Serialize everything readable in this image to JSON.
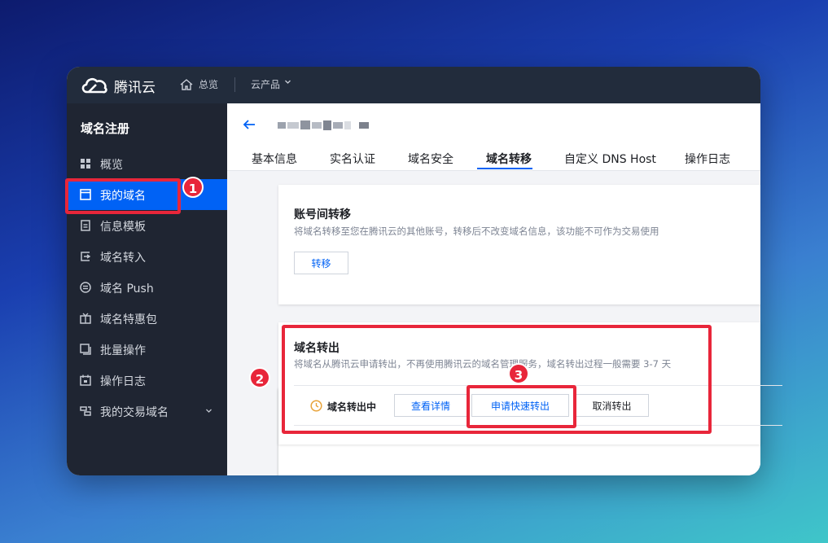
{
  "topbar": {
    "brand": "腾讯云",
    "home": "总览",
    "products": "云产品"
  },
  "sidebar": {
    "title": "域名注册",
    "items": [
      {
        "label": "概览",
        "icon": "grid-icon"
      },
      {
        "label": "我的域名",
        "icon": "window-icon",
        "active": true
      },
      {
        "label": "信息模板",
        "icon": "document-icon"
      },
      {
        "label": "域名转入",
        "icon": "transfer-in-icon"
      },
      {
        "label": "域名 Push",
        "icon": "push-icon"
      },
      {
        "label": "域名特惠包",
        "icon": "gift-icon"
      },
      {
        "label": "批量操作",
        "icon": "batch-icon"
      },
      {
        "label": "操作日志",
        "icon": "calendar-icon"
      },
      {
        "label": "我的交易域名",
        "icon": "trade-icon"
      }
    ]
  },
  "tabs": [
    {
      "label": "基本信息"
    },
    {
      "label": "实名认证"
    },
    {
      "label": "域名安全"
    },
    {
      "label": "域名转移",
      "active": true
    },
    {
      "label": "自定义 DNS Host"
    },
    {
      "label": "操作日志"
    }
  ],
  "transfer_between_accounts": {
    "title": "账号间转移",
    "desc": "将域名转移至您在腾讯云的其他账号，转移后不改变域名信息，该功能不可作为交易使用",
    "button": "转移"
  },
  "transfer_out": {
    "title": "域名转出",
    "desc": "将域名从腾讯云申请转出，不再使用腾讯云的域名管理服务，域名转出过程一般需要 3-7 天",
    "status": "域名转出中",
    "view_details": "查看详情",
    "fast_transfer": "申请快速转出",
    "cancel_transfer": "取消转出"
  },
  "annotations": {
    "badge1": "1",
    "badge2": "2",
    "badge3": "3"
  },
  "colors": {
    "accent": "#0062f5",
    "highlight": "#e8263a",
    "sidebar_bg": "#1f2532",
    "topbar_bg": "#222c3c"
  }
}
